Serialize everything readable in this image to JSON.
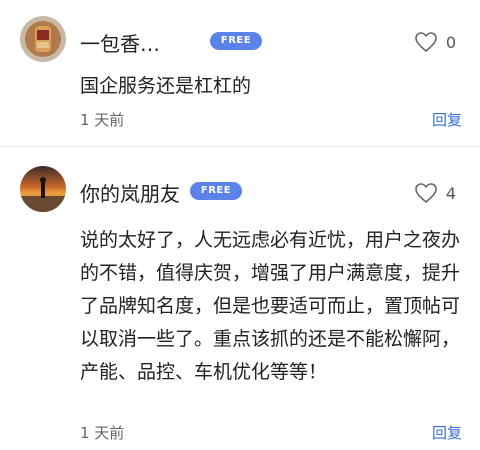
{
  "comments": [
    {
      "username": "一包香…",
      "badge": "FREE",
      "likes": "0",
      "text": "国企服务还是杠杠的",
      "time": "1 天前",
      "reply": "回复"
    },
    {
      "username": "你的岚朋友",
      "badge": "FREE",
      "likes": "4",
      "text": "说的太好了，人无远虑必有近忧，用户之夜办的不错，值得庆贺，增强了用户满意度，提升了品牌知名度，但是也要适可而止，置顶帖可以取消一些了。重点该抓的还是不能松懈阿，产能、品控、车机优化等等！",
      "time": "1 天前",
      "reply": "回复"
    }
  ],
  "colors": {
    "badge": "#5b82e8",
    "reply": "#3a6fd8",
    "divider": "#ececec"
  }
}
